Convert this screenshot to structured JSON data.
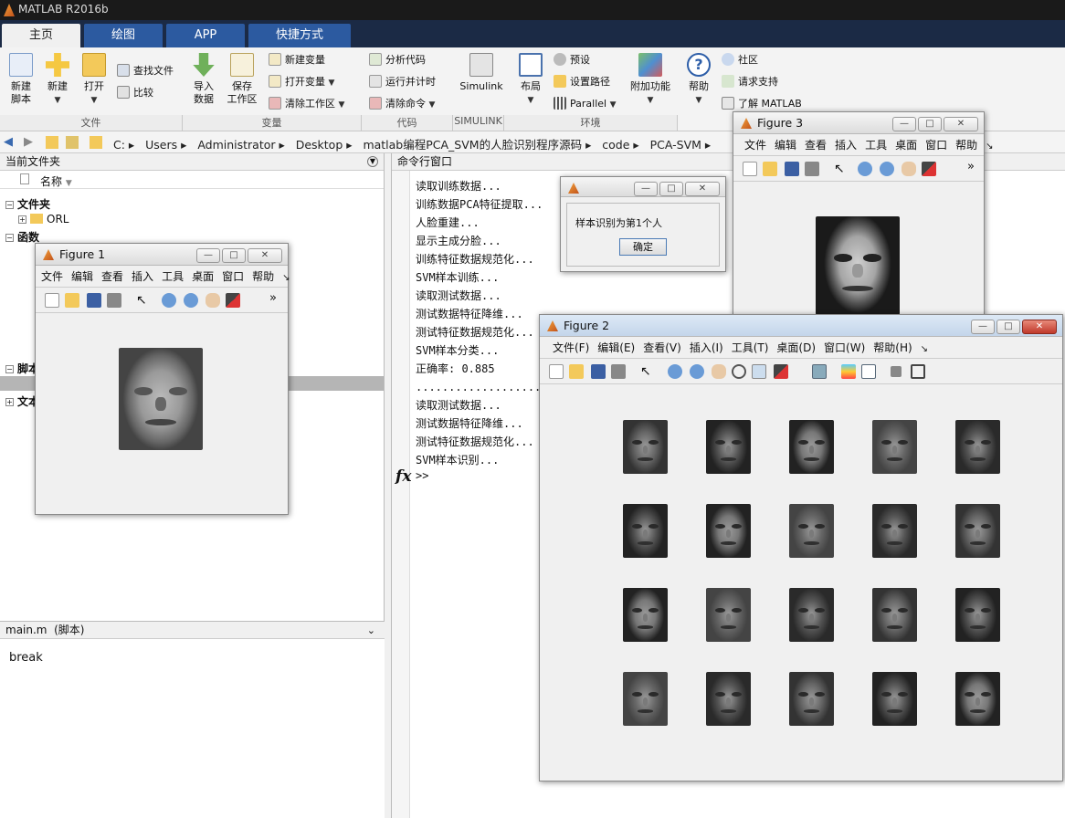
{
  "app": {
    "title": "MATLAB R2016b"
  },
  "tabs": [
    {
      "label": "主页",
      "active": true
    },
    {
      "label": "绘图",
      "active": false
    },
    {
      "label": "APP",
      "active": false
    },
    {
      "label": "快捷方式",
      "active": false
    }
  ],
  "ribbon": {
    "new_script": "新建\n脚本",
    "new": "新建",
    "open": "打开",
    "find_files": "查找文件",
    "compare": "比较",
    "import_data": "导入\n数据",
    "save_workspace": "保存\n工作区",
    "new_variable": "新建变量",
    "open_variable": "打开变量",
    "clear_workspace": "清除工作区",
    "analyze_code": "分析代码",
    "run_and_time": "运行并计时",
    "clear_commands": "清除命令",
    "simulink": "Simulink",
    "layout": "布局",
    "preferences": "预设",
    "set_path": "设置路径",
    "parallel": "Parallel",
    "addons": "附加功能",
    "help": "帮助",
    "community": "社区",
    "request_support": "请求支持",
    "learn_matlab": "了解 MATLAB",
    "groups": {
      "file": "文件",
      "variable": "变量",
      "code": "代码",
      "simulink": "SIMULINK",
      "environment": "环境"
    }
  },
  "address": {
    "segments": [
      "C:",
      "Users",
      "Administrator",
      "Desktop",
      "matlab编程PCA_SVM的人脸识别程序源码",
      "code",
      "PCA-SVM"
    ]
  },
  "file_panel": {
    "title": "当前文件夹",
    "name_header": "名称",
    "folder_group": "文件夹",
    "orl": "ORL",
    "function_group": "函数",
    "script_group": "脚本",
    "text_group": "文本",
    "detail_title": "main.m  (脚本)",
    "detail_content": "break"
  },
  "command_window": {
    "title": "命令行窗口",
    "lines": [
      "读取训练数据...",
      "训练数据PCA特征提取...",
      "人脸重建...",
      "显示主成分脸...",
      "训练特征数据规范化...",
      "SVM样本训练...",
      "读取测试数据...",
      "测试数据特征降维...",
      "测试特征数据规范化...",
      "SVM样本分类...",
      "正确率: 0.885",
      "..............................",
      "读取测试数据...",
      "测试数据特征降维...",
      "测试特征数据规范化...",
      "SVM样本识别..."
    ],
    "fx": "fx",
    "prompt": ">>"
  },
  "figure1": {
    "title": "Figure 1",
    "menu": [
      "文件",
      "编辑",
      "查看",
      "插入",
      "工具",
      "桌面",
      "窗口",
      "帮助"
    ]
  },
  "figure3": {
    "title": "Figure 3",
    "menu": [
      "文件",
      "编辑",
      "查看",
      "插入",
      "工具",
      "桌面",
      "窗口",
      "帮助"
    ]
  },
  "figure2": {
    "title": "Figure 2",
    "menu": [
      "文件(F)",
      "编辑(E)",
      "查看(V)",
      "插入(I)",
      "工具(T)",
      "桌面(D)",
      "窗口(W)",
      "帮助(H)"
    ]
  },
  "dialog": {
    "message": "样本识别为第1个人",
    "ok": "确定"
  }
}
